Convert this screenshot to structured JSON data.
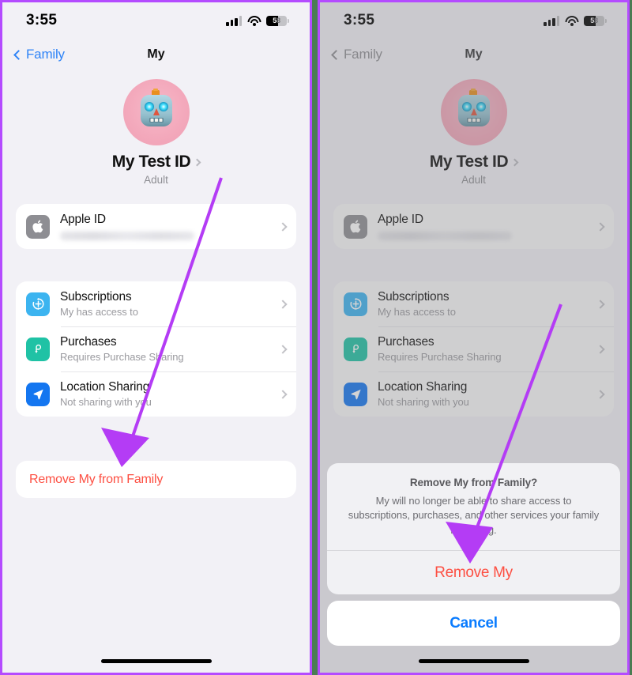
{
  "status_bar": {
    "time": "3:55",
    "battery_percent": "58",
    "cellular_icon": "signal-bars-icon",
    "wifi_icon": "wifi-icon",
    "battery_icon": "battery-icon"
  },
  "nav": {
    "back_label": "Family",
    "title": "My",
    "back_icon": "chevron-left-icon"
  },
  "profile": {
    "name": "My Test ID",
    "role": "Adult",
    "avatar_icon": "robot-memoji-avatar",
    "disclosure_icon": "chevron-right-icon"
  },
  "apple_id_row": {
    "title": "Apple ID",
    "icon": "apple-logo-icon",
    "value_redacted": "",
    "chevron_icon": "chevron-right-icon"
  },
  "list_rows": [
    {
      "title": "Subscriptions",
      "subtitle": "My has access to",
      "icon": "subscriptions-icon",
      "color": "#3cb4f0"
    },
    {
      "title": "Purchases",
      "subtitle": "Requires Purchase Sharing",
      "icon": "purchases-icon",
      "color": "#1fc2a5"
    },
    {
      "title": "Location Sharing",
      "subtitle": "Not sharing with you",
      "icon": "location-sharing-icon",
      "color": "#1476f0"
    }
  ],
  "danger_action": {
    "label": "Remove My from Family"
  },
  "action_sheet": {
    "title": "Remove My from Family?",
    "message": "My will no longer be able to share access to subscriptions, purchases, and other services your family is sharing.",
    "destructive_label": "Remove My",
    "cancel_label": "Cancel"
  },
  "annotations": {
    "arrow_color": "#b43cf5",
    "left_arrow_target": "Remove My from Family",
    "right_arrow_target": "Remove My"
  },
  "theme": {
    "accent_blue": "#0a7cff",
    "destructive_red": "#fd4f42",
    "background": "#f2f1f6",
    "panel_border": "#b44bff",
    "divider": "#4a7c52"
  }
}
